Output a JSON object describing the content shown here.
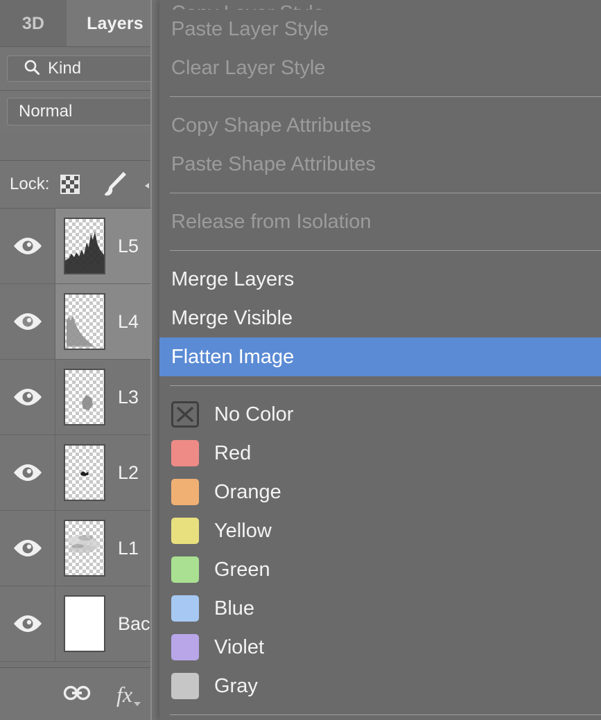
{
  "app": {
    "name": "Adobe Photoshop Layers Panel with context menu"
  },
  "colors": {
    "panel_bg": "#747474",
    "menu_bg": "#6a6a6a",
    "highlight": "#5b8bd4",
    "text": "#f3f3f3",
    "text_disabled": "#9c9c9c",
    "separator": "#a0a0a0",
    "row_selected": "#898989"
  },
  "panel": {
    "tabs": [
      {
        "label": "3D",
        "active": false,
        "name": "tab-3d"
      },
      {
        "label": "Layers",
        "active": true,
        "name": "tab-layers"
      }
    ],
    "filter": {
      "icon": "search-icon",
      "value": "Kind",
      "placeholder": "Kind"
    },
    "blend_mode": {
      "value": "Normal"
    },
    "lock": {
      "label": "Lock:",
      "icons": [
        "transparency-checkerboard-icon",
        "paintbrush-icon"
      ]
    },
    "layers": [
      {
        "name": "L5",
        "visible": true,
        "selected": true,
        "thumb": "mountain-ridge",
        "visibility_icon": "eye-icon"
      },
      {
        "name": "L4",
        "visible": true,
        "selected": true,
        "thumb": "soft-hill",
        "visibility_icon": "eye-icon"
      },
      {
        "name": "L3",
        "visible": true,
        "selected": false,
        "thumb": "small-blob",
        "visibility_icon": "eye-icon"
      },
      {
        "name": "L2",
        "visible": true,
        "selected": false,
        "thumb": "tiny-speck",
        "visibility_icon": "eye-icon"
      },
      {
        "name": "L1",
        "visible": true,
        "selected": false,
        "thumb": "clouds",
        "visibility_icon": "eye-icon"
      },
      {
        "name": "Bac",
        "visible": true,
        "selected": false,
        "thumb": "white-solid",
        "visibility_icon": "eye-icon"
      }
    ],
    "bottom_bar": {
      "link_label": "Link layers",
      "fx_label": "fx"
    }
  },
  "context_menu": {
    "items": [
      {
        "label": "Copy Layer Style",
        "type": "item",
        "state": "disabled",
        "clipped": true
      },
      {
        "label": "Paste Layer Style",
        "type": "item",
        "state": "disabled"
      },
      {
        "label": "Clear Layer Style",
        "type": "item",
        "state": "disabled"
      },
      {
        "label": "",
        "type": "separator"
      },
      {
        "label": "Copy Shape Attributes",
        "type": "item",
        "state": "disabled"
      },
      {
        "label": "Paste Shape Attributes",
        "type": "item",
        "state": "disabled"
      },
      {
        "label": "",
        "type": "separator"
      },
      {
        "label": "Release from Isolation",
        "type": "item",
        "state": "disabled"
      },
      {
        "label": "",
        "type": "separator"
      },
      {
        "label": "Merge Layers",
        "type": "item",
        "state": "enabled"
      },
      {
        "label": "Merge Visible",
        "type": "item",
        "state": "enabled"
      },
      {
        "label": "Flatten Image",
        "type": "item",
        "state": "highlighted"
      },
      {
        "label": "",
        "type": "separator"
      },
      {
        "label": "No Color",
        "type": "color",
        "state": "enabled",
        "swatch": "none",
        "swatch_icon": "x-mark-icon"
      },
      {
        "label": "Red",
        "type": "color",
        "state": "enabled",
        "swatch": "#ee8b87"
      },
      {
        "label": "Orange",
        "type": "color",
        "state": "enabled",
        "swatch": "#f0b073"
      },
      {
        "label": "Yellow",
        "type": "color",
        "state": "enabled",
        "swatch": "#e8e07e"
      },
      {
        "label": "Green",
        "type": "color",
        "state": "enabled",
        "swatch": "#a9e092"
      },
      {
        "label": "Blue",
        "type": "color",
        "state": "enabled",
        "swatch": "#a6c8f2"
      },
      {
        "label": "Violet",
        "type": "color",
        "state": "enabled",
        "swatch": "#b8a6e8"
      },
      {
        "label": "Gray",
        "type": "color",
        "state": "enabled",
        "swatch": "#c6c6c6"
      },
      {
        "label": "",
        "type": "separator"
      }
    ]
  }
}
